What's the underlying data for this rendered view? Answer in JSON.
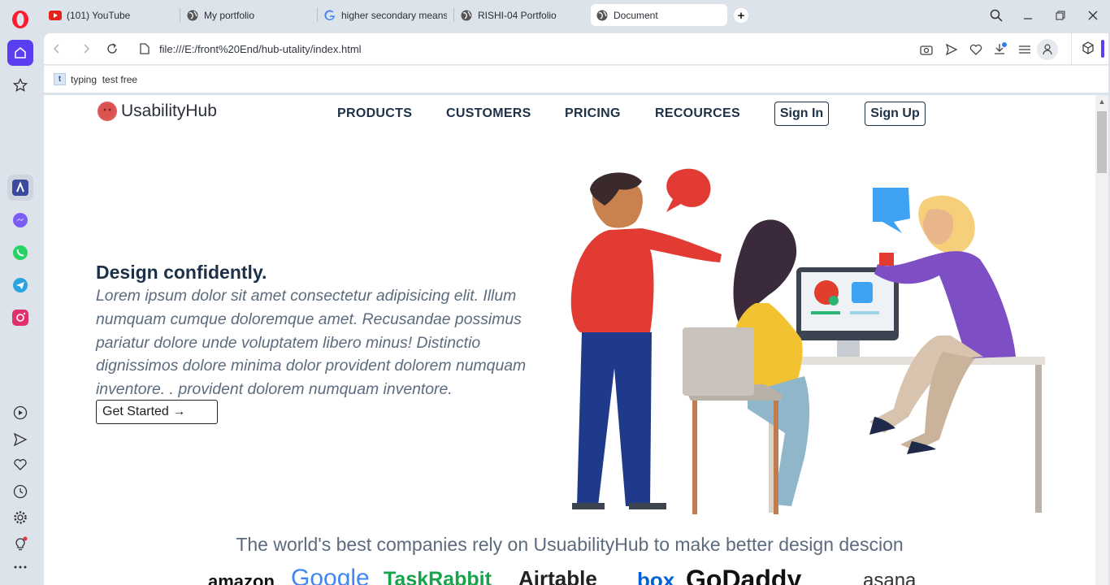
{
  "browser": {
    "tabs": [
      {
        "label": "(101) YouTube",
        "icon": "youtube-icon",
        "active": false
      },
      {
        "label": "My portfolio",
        "icon": "globe-icon",
        "active": false
      },
      {
        "label": "higher secondary means",
        "icon": "google-icon",
        "active": false
      },
      {
        "label": "RISHI-04 Portfolio",
        "icon": "globe-icon",
        "active": false
      },
      {
        "label": "Document",
        "icon": "globe-icon",
        "active": true
      }
    ],
    "url": "file:///E:/front%20End/hub-utality/index.html",
    "bookmarks": [
      {
        "label": "typing  test free",
        "icon_letter": "t"
      }
    ],
    "accent_color": "#5a3ff0"
  },
  "site": {
    "logo_text": "UsabilityHub",
    "nav": {
      "products": "PRODUCTS",
      "customers": "CUSTOMERS",
      "pricing": "PRICING",
      "resources": "RECOURCES",
      "sign_in": "Sign In",
      "sign_up": "Sign Up"
    },
    "hero": {
      "title": "Design confidently.",
      "text": "Lorem ipsum dolor sit amet consectetur adipisicing elit. Illum numquam cumque doloremque amet. Recusandae possimus pariatur dolore unde voluptatem libero minus! Distinctio dignissimos dolore minima dolor provident dolorem numquam inventore. . provident dolorem numquam inventore.",
      "cta": "Get Started →"
    },
    "companies": {
      "title": "The world's best companies rely on UsuabilityHub to make better design descion",
      "logos": [
        "amazon",
        "Google",
        "TaskRabbit",
        "Airtable",
        "box",
        "GoDaddy",
        "asana"
      ]
    }
  }
}
